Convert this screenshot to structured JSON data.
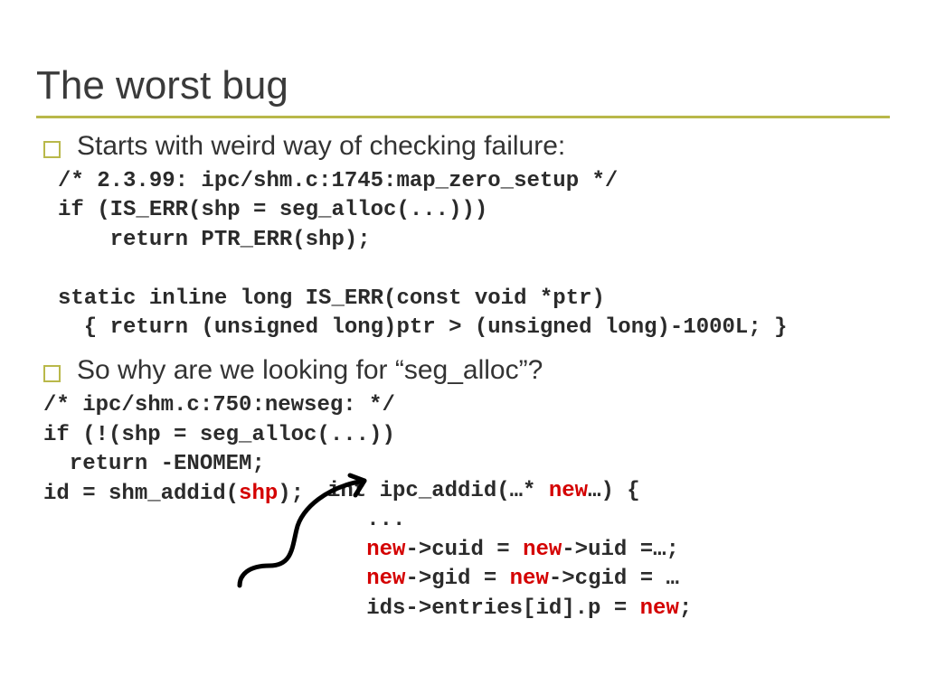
{
  "title": "The worst bug",
  "bullet1": "Starts with weird way of checking failure:",
  "bullet2": "So why are we looking for “seg_alloc”?",
  "code1": {
    "l1": "/* 2.3.99: ipc/shm.c:1745:map_zero_setup */",
    "l2": "if (IS_ERR(shp = seg_alloc(...)))",
    "l3": "    return PTR_ERR(shp);",
    "l4": "",
    "l5": "static inline long IS_ERR(const void *ptr)",
    "l6": "  { return (unsigned long)ptr > (unsigned long)-1000L; }"
  },
  "code2": {
    "l1": "/* ipc/shm.c:750:newseg: */",
    "l2": "if (!(shp = seg_alloc(...))",
    "l3": "  return -ENOMEM;",
    "l4a": "id = shm_addid(",
    "l4_shp": "shp",
    "l4b": ");"
  },
  "code3": {
    "l1a": "int ipc_addid(…* ",
    "l1_new": "new",
    "l1b": "…) {",
    "l2": "   ...",
    "l3a": "   ",
    "l3_new1": "new",
    "l3b": "->cuid = ",
    "l3_new2": "new",
    "l3c": "->uid =…;",
    "l4a": "   ",
    "l4_new1": "new",
    "l4b": "->gid = ",
    "l4_new2": "new",
    "l4c": "->cgid = …",
    "l5a": "   ids->entries[id].p = ",
    "l5_new": "new",
    "l5b": ";"
  }
}
